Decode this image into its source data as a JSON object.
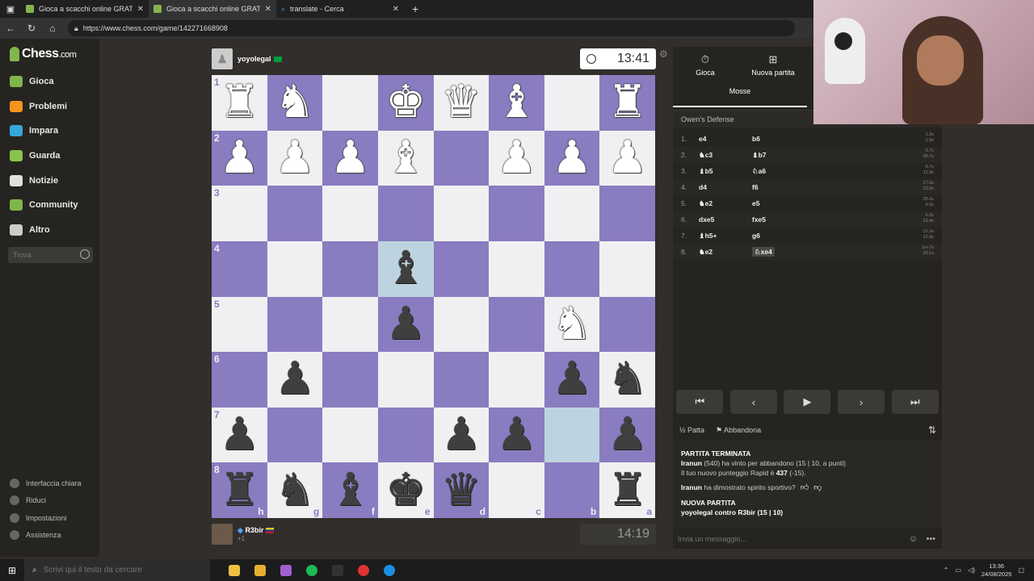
{
  "browser": {
    "tabs": [
      {
        "title": "Gioca a scacchi online GRATIS - S",
        "active": false
      },
      {
        "title": "Gioca a scacchi online GRATIS - S",
        "active": true
      },
      {
        "title": "translate - Cerca",
        "active": false
      }
    ],
    "url": "https://www.chess.com/game/142271668908"
  },
  "sidebar": {
    "logo": "Chess",
    "logo_suffix": ".com",
    "items": [
      {
        "label": "Gioca",
        "color": "#81b64c"
      },
      {
        "label": "Problemi",
        "color": "#f7941d"
      },
      {
        "label": "Impara",
        "color": "#36a8d9"
      },
      {
        "label": "Guarda",
        "color": "#8bc34a"
      },
      {
        "label": "Notizie",
        "color": "#e0e0e0"
      },
      {
        "label": "Community",
        "color": "#81b64c"
      },
      {
        "label": "Altro",
        "color": "#cccccc"
      }
    ],
    "search_placeholder": "Trova",
    "bottom": [
      "Interfaccia chiara",
      "Riduci",
      "Impostazioni",
      "Assistenza"
    ]
  },
  "top_player": {
    "name": "yoyolegal",
    "clock": "13:41"
  },
  "bottom_player": {
    "name": "R3bir",
    "sub": "+1",
    "clock": "14:19"
  },
  "board": {
    "ranks": [
      "1",
      "2",
      "3",
      "4",
      "5",
      "6",
      "7",
      "8"
    ],
    "files": [
      "h",
      "g",
      "f",
      "e",
      "d",
      "c",
      "b",
      "a"
    ],
    "rows": [
      [
        "wR",
        "wN",
        "",
        "wK",
        "wQ",
        "wB",
        "",
        "wR"
      ],
      [
        "wP",
        "wP",
        "wP",
        "wB",
        "",
        "wP",
        "wP",
        "wP"
      ],
      [
        "",
        "",
        "",
        "",
        "",
        "",
        "",
        ""
      ],
      [
        "",
        "",
        "",
        "bB",
        "",
        "",
        "",
        ""
      ],
      [
        "",
        "",
        "",
        "bP",
        "",
        "",
        "wN",
        ""
      ],
      [
        "",
        "bP",
        "",
        "",
        "",
        "",
        "bP",
        "bN"
      ],
      [
        "bP",
        "",
        "",
        "",
        "bP",
        "bP",
        "",
        "bP"
      ],
      [
        "bR",
        "bN",
        "bB",
        "bK",
        "bQ",
        "",
        "",
        "bR"
      ]
    ],
    "highlights": [
      "3-3",
      "6-6"
    ]
  },
  "panel": {
    "tab_play": "Gioca",
    "tab_new": "Nuova partita",
    "tab_moves": "Mosse",
    "opening": "Owen's Defense",
    "moves": [
      {
        "n": "1.",
        "w": "e4",
        "b": "b6",
        "t": [
          "1.2s",
          "1.9s"
        ]
      },
      {
        "n": "2.",
        "w": "♞c3",
        "b": "♝b7",
        "t": [
          "3.7s",
          "26.7s"
        ]
      },
      {
        "n": "3.",
        "w": "♝b5",
        "b": "♘a6",
        "t": [
          "9.7s",
          "11.9s"
        ]
      },
      {
        "n": "4.",
        "w": "d4",
        "b": "f6",
        "t": [
          "17.9s",
          "23.9s"
        ]
      },
      {
        "n": "5.",
        "w": "♞e2",
        "b": "e5",
        "t": [
          "25.3s",
          "9.9s"
        ]
      },
      {
        "n": "6.",
        "w": "dxe5",
        "b": "fxe5",
        "t": [
          "6.3s",
          "13.4s"
        ]
      },
      {
        "n": "7.",
        "w": "♝h5+",
        "b": "g6",
        "t": [
          "12.3s",
          "12.9s"
        ]
      },
      {
        "n": "8.",
        "w": "♞e2",
        "b": "♘xe4",
        "t": [
          "1m 7s",
          "20.1s"
        ]
      }
    ],
    "draw": "Patta",
    "resign": "Abbandona",
    "chat": {
      "hdr1": "PARTITA TERMINATA",
      "line1_name": "Iranun",
      "line1_rest": "(540) ha vinto per abbandono (15 | 10, a punti)",
      "line2_pre": "Il tuo nuovo punteggio Rapid è",
      "line2_val": "437",
      "line2_post": "(-15).",
      "line3_name": "Iranun",
      "line3_rest": "ha dimostrato spirito sportivo?",
      "hdr2": "NUOVA PARTITA",
      "line4": "yoyolegal contro R3bir (15 | 10)"
    },
    "chat_placeholder": "Invia un messaggio..."
  },
  "taskbar": {
    "search_placeholder": "Scrivi qui il testo da cercare",
    "time": "13:36",
    "date": "24/08/2025",
    "apps": [
      "#f0c040",
      "#e8b030",
      "#a060d0",
      "#1db954",
      "#333333",
      "#dd3333",
      "#1a8fe0"
    ]
  }
}
